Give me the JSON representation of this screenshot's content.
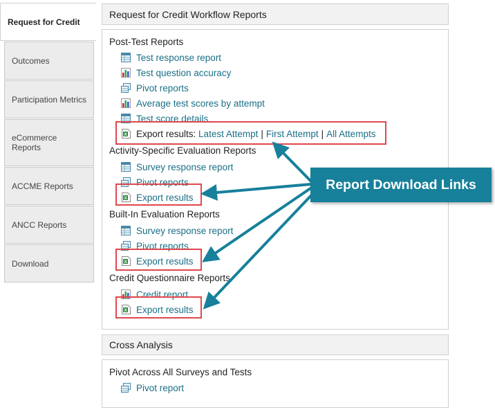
{
  "sidebar": {
    "tabs": [
      {
        "label": "Request for Credit"
      },
      {
        "label": "Outcomes"
      },
      {
        "label": "Participation Metrics"
      },
      {
        "label": "eCommerce Reports"
      },
      {
        "label": "ACCME Reports"
      },
      {
        "label": "ANCC Reports"
      },
      {
        "label": "Download"
      }
    ]
  },
  "workflow": {
    "header": "Request for Credit Workflow Reports",
    "sections": [
      {
        "title": "Post-Test Reports",
        "items": [
          {
            "icon": "table-report-icon",
            "label": "Test response report"
          },
          {
            "icon": "bar-chart-icon",
            "label": "Test question accuracy"
          },
          {
            "icon": "pivot-icon",
            "label": "Pivot reports"
          },
          {
            "icon": "bar-chart-icon",
            "label": "Average test scores by attempt"
          },
          {
            "icon": "table-report-icon",
            "label": "Test score details"
          }
        ],
        "export": {
          "prefix": "Export results:",
          "links": [
            "Latest Attempt",
            "First Attempt",
            "All Attempts"
          ],
          "separator": "|"
        }
      },
      {
        "title": "Activity-Specific Evaluation Reports",
        "items": [
          {
            "icon": "table-report-icon",
            "label": "Survey response report"
          },
          {
            "icon": "pivot-icon",
            "label": "Pivot reports"
          }
        ],
        "export_label": "Export results"
      },
      {
        "title": "Built-In Evaluation Reports",
        "items": [
          {
            "icon": "table-report-icon",
            "label": "Survey response report"
          },
          {
            "icon": "pivot-icon",
            "label": "Pivot reports"
          }
        ],
        "export_label": "Export results"
      },
      {
        "title": "Credit Questionnaire Reports",
        "items": [
          {
            "icon": "bar-chart-icon",
            "label": "Credit report"
          }
        ],
        "export_label": "Export results"
      }
    ]
  },
  "cross_analysis": {
    "header": "Cross Analysis"
  },
  "pivot_all": {
    "title": "Pivot Across All Surveys and Tests",
    "link": "Pivot report"
  },
  "callout": {
    "label": "Report Download Links"
  },
  "colors": {
    "link": "#1a6f86",
    "highlight": "#e0474c",
    "callout": "#17809b"
  }
}
